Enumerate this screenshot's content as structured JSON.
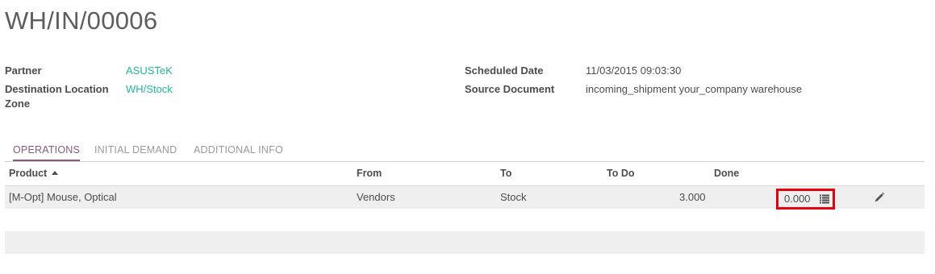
{
  "record": {
    "title": "WH/IN/00006"
  },
  "fields": {
    "partner_label": "Partner",
    "partner_value": "ASUSTeK",
    "dest_label": "Destination Location",
    "dest_label_2": "Zone",
    "dest_value": "WH/Stock",
    "sched_label": "Scheduled Date",
    "sched_value": "11/03/2015 09:03:30",
    "source_label": "Source Document",
    "source_value": "incoming_shipment your_company warehouse"
  },
  "tabs": [
    {
      "label": "OPERATIONS",
      "active": true
    },
    {
      "label": "INITIAL DEMAND",
      "active": false
    },
    {
      "label": "ADDITIONAL INFO",
      "active": false
    }
  ],
  "table": {
    "headers": {
      "product": "Product",
      "from": "From",
      "to": "To",
      "todo": "To Do",
      "done": "Done"
    },
    "rows": [
      {
        "product": "[M-Opt] Mouse, Optical",
        "from": "Vendors",
        "to": "Stock",
        "todo": "3.000",
        "done": "0.000"
      }
    ]
  },
  "icons": {
    "sort": "sort-ascending-icon",
    "list": "list-icon",
    "edit": "pencil-icon"
  },
  "colors": {
    "link": "#21b799",
    "active_tab": "#875a7b",
    "highlight": "#e3000f",
    "row_bg": "#eeefee"
  }
}
